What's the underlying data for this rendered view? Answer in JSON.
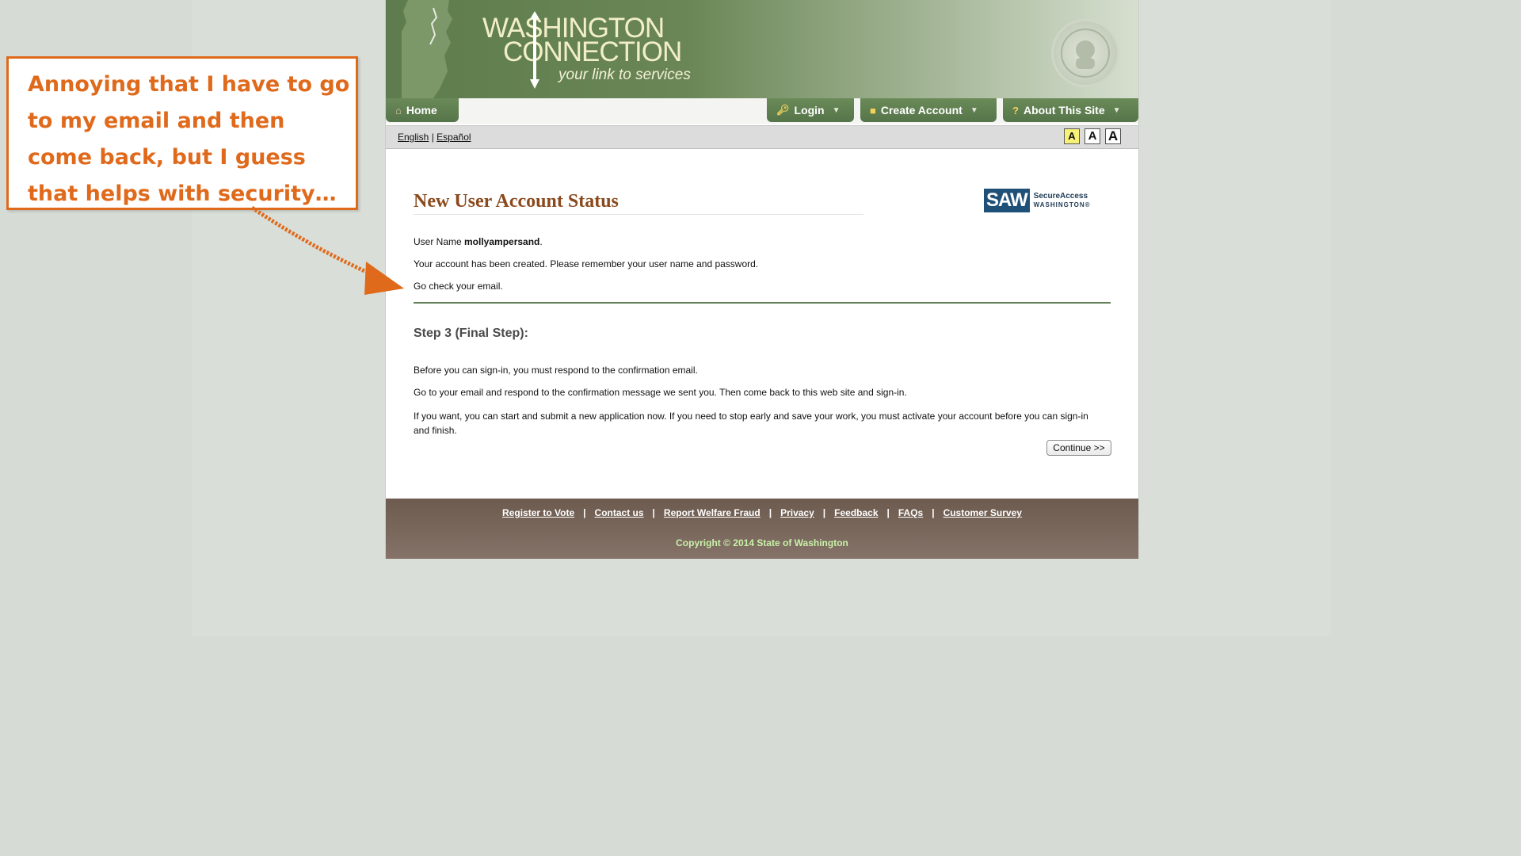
{
  "site": {
    "logo": {
      "line1": "WASHINGTON",
      "line2": "CONNECTION",
      "tagline": "your link to services"
    },
    "nav": {
      "home": "Home",
      "login": "Login",
      "create_account": "Create Account",
      "about": "About This Site"
    },
    "lang": {
      "english": "English",
      "separator": "|",
      "spanish": "Español"
    },
    "text_size": [
      "A",
      "A",
      "A"
    ]
  },
  "content": {
    "title": "New User Account Status",
    "saw": {
      "box": "SAW",
      "line1": "SecureAccess",
      "line2": "WASHINGTON®"
    },
    "username_label": "User Name ",
    "username": "mollyampersand",
    "username_end": ".",
    "created_msg": "Your account has been created. Please remember your user name and password.",
    "check_email": "Go check your email.",
    "step_title": "Step 3 (Final Step):",
    "step_p1": "Before you can sign-in, you must respond to the confirmation email.",
    "step_p2": "Go to your email and respond to the confirmation message we sent you. Then come back to this web site and sign-in.",
    "step_p3": "If you want, you can start and submit a new application now. If you need to stop early and save your work, you must activate your account before you can sign-in and finish.",
    "continue_label": "Continue >>"
  },
  "footer": {
    "links": [
      "Register to Vote",
      "Contact us",
      "Report Welfare Fraud",
      "Privacy",
      "Feedback",
      "FAQs",
      "Customer Survey"
    ],
    "separator": "|",
    "copyright": "Copyright © 2014 State of Washington"
  },
  "annotation": {
    "text": "Annoying that I have to go to my email and then come back, but I guess that helps with security…"
  },
  "colors": {
    "header_green": "#5e7c4d",
    "title_brown": "#8a4a1d",
    "footer_brown": "#6d5b4f",
    "annotation_orange": "#e06a1c",
    "copyright_green": "#c9f2a9"
  }
}
